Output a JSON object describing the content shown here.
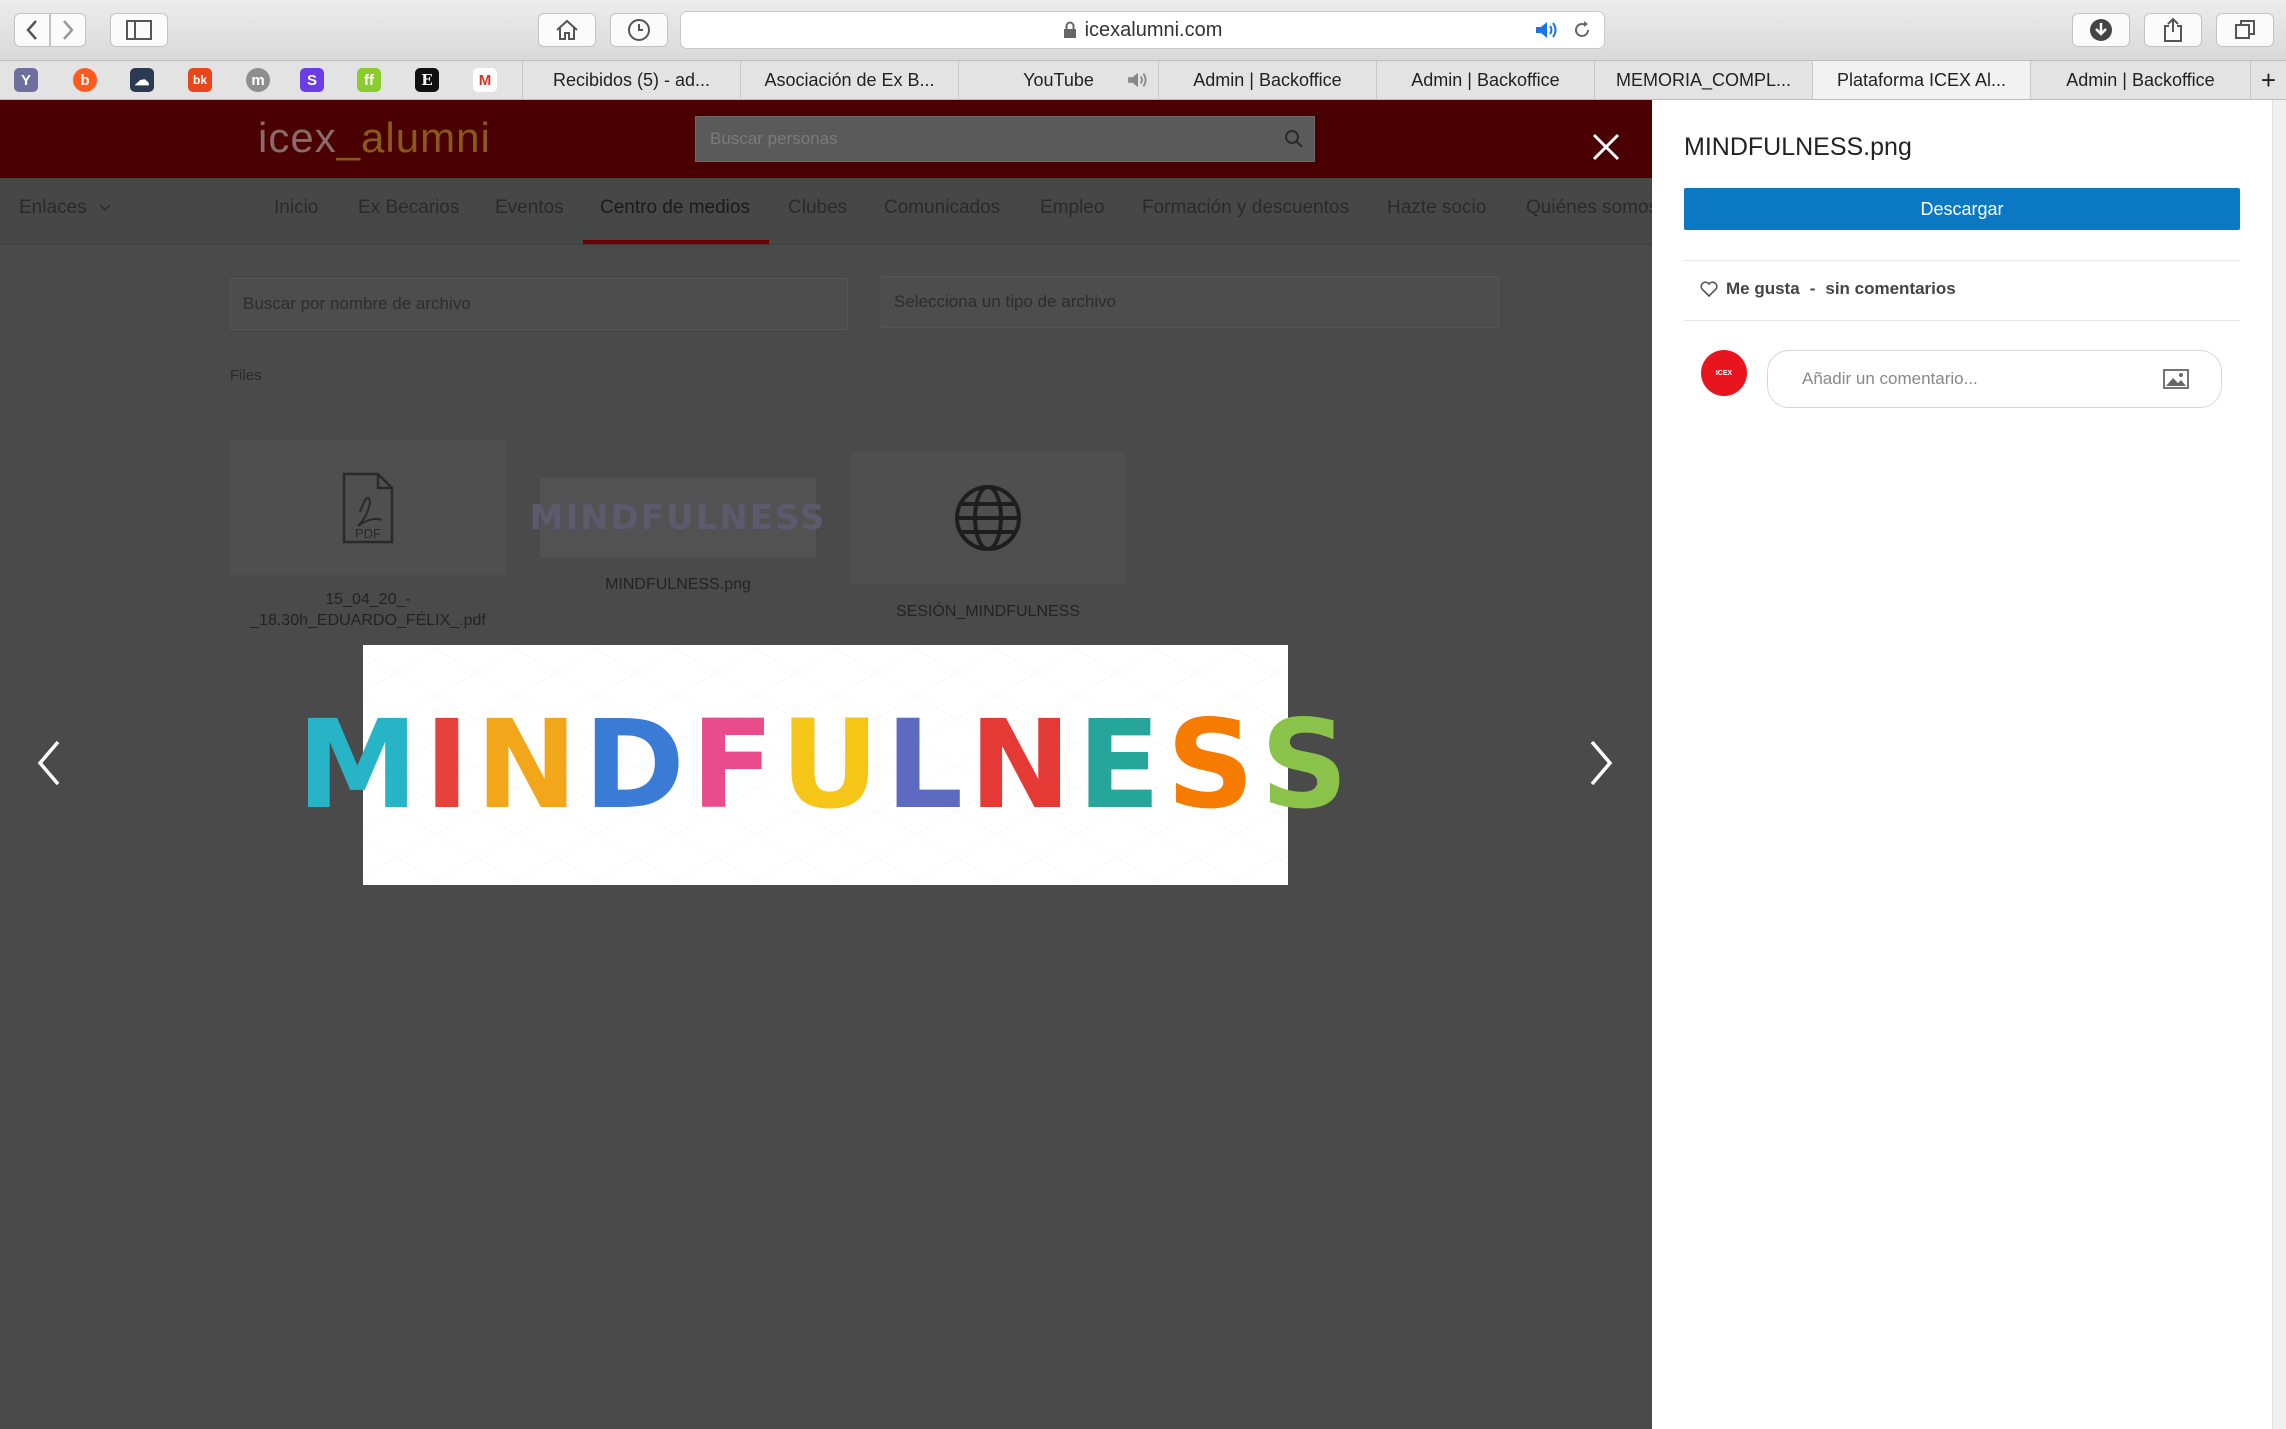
{
  "browser": {
    "url": "icexalumni.com",
    "bookmark_icons": [
      {
        "name": "yahoo",
        "glyph": "Y",
        "color": "#6e6e9e"
      },
      {
        "name": "badoo",
        "glyph": "b",
        "color": "#ff5a1f"
      },
      {
        "name": "onedrive",
        "glyph": "☁",
        "color": "#2b3a52"
      },
      {
        "name": "bk",
        "glyph": "bk",
        "color": "#e8471c"
      },
      {
        "name": "medium",
        "glyph": "m",
        "color": "#8e8e8e"
      },
      {
        "name": "s-app",
        "glyph": "S",
        "color": "#6a3de8"
      },
      {
        "name": "ff",
        "glyph": "ff",
        "color": "#8acc2e"
      },
      {
        "name": "e-icon",
        "glyph": "E",
        "color": "#111111"
      },
      {
        "name": "gmail",
        "glyph": "M",
        "color": "#d93025"
      }
    ],
    "tabs": [
      {
        "label": "Recibidos (5) - ad..."
      },
      {
        "label": "Asociación de Ex B..."
      },
      {
        "label": "YouTube"
      },
      {
        "label": "Admin | Backoffice"
      },
      {
        "label": "Admin | Backoffice"
      },
      {
        "label": "MEMORIA_COMPL..."
      },
      {
        "label": "Plataforma ICEX Al..."
      },
      {
        "label": "Admin | Backoffice"
      }
    ],
    "new_tab": "+"
  },
  "site": {
    "logo_left": "icex",
    "logo_right": "_alumni",
    "people_search_placeholder": "Buscar personas",
    "links_label": "Enlaces",
    "nav": [
      {
        "label": "Inicio"
      },
      {
        "label": "Ex Becarios"
      },
      {
        "label": "Eventos"
      },
      {
        "label": "Centro de medios"
      },
      {
        "label": "Clubes"
      },
      {
        "label": "Comunicados"
      },
      {
        "label": "Empleo"
      },
      {
        "label": "Formación y descuentos"
      },
      {
        "label": "Hazte socio"
      },
      {
        "label": "Quiénes somos"
      }
    ],
    "file_search_placeholder": "Buscar por nombre de archivo",
    "file_type_placeholder": "Selecciona un tipo de archivo",
    "files_heading": "Files",
    "files": [
      {
        "name": "15_04_20_-\n_18.30h_EDUARDO_FÉLIX_.pdf",
        "icon": "pdf-file-icon",
        "badge": "PDF"
      },
      {
        "name": "MINDFULNESS.png",
        "icon": "image-thumbnail",
        "thumb_text": "MINDFULNESS"
      },
      {
        "name": "SESIÓN_MINDFULNESS",
        "icon": "globe-icon"
      }
    ]
  },
  "lightbox": {
    "image_text": "MINDFULNESS",
    "letter_colors": [
      "#27b4c6",
      "#e8413c",
      "#f2a71b",
      "#3a7bd5",
      "#e94b8b",
      "#f5c518",
      "#5c6bc0",
      "#e53935",
      "#26a69a",
      "#f57c00",
      "#8bc34a"
    ]
  },
  "panel": {
    "title": "MINDFULNESS.png",
    "download_label": "Descargar",
    "like_label": "Me gusta",
    "separator": "-",
    "comments_label": "sin comentarios",
    "avatar_text": "ICEX",
    "comment_placeholder": "Añadir un comentario..."
  }
}
